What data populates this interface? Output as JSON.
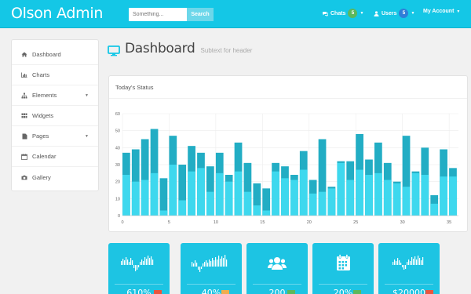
{
  "app": {
    "brand": "Olson Admin"
  },
  "search": {
    "placeholder": "Something...",
    "button_label": "Search"
  },
  "nav": {
    "chats_label": "Chats",
    "chats_count": "5",
    "users_label": "Users",
    "users_count": "5",
    "account_label": "My Account"
  },
  "sidebar": {
    "items": [
      {
        "label": "Dashboard",
        "icon": "home-icon"
      },
      {
        "label": "Charts",
        "icon": "bar-chart-icon"
      },
      {
        "label": "Elements",
        "icon": "sitemap-icon",
        "has_submenu": true
      },
      {
        "label": "Widgets",
        "icon": "grid-icon"
      },
      {
        "label": "Pages",
        "icon": "file-icon",
        "has_submenu": true
      },
      {
        "label": "Calendar",
        "icon": "calendar-icon"
      },
      {
        "label": "Gallery",
        "icon": "camera-icon"
      }
    ]
  },
  "header": {
    "title": "Dashboard",
    "subtitle": "Subtext for header",
    "icon": "monitor-icon"
  },
  "panel": {
    "title": "Today's Status"
  },
  "chart_data": {
    "type": "bar",
    "x": [
      0,
      1,
      2,
      3,
      4,
      5,
      6,
      7,
      8,
      9,
      10,
      11,
      12,
      13,
      14,
      15,
      16,
      17,
      18,
      19,
      20,
      21,
      22,
      23,
      24,
      25,
      26,
      27,
      28,
      29,
      30,
      31,
      32,
      33,
      34,
      35
    ],
    "series": [
      {
        "values": [
          37,
          39,
          45,
          51,
          22,
          47,
          30,
          41,
          37,
          29,
          37,
          24,
          43,
          31,
          19,
          16,
          31,
          29,
          24,
          38,
          21,
          45,
          17,
          32,
          32,
          48,
          33,
          43,
          31,
          20,
          47,
          26,
          40,
          12,
          39,
          28
        ]
      },
      {
        "values": [
          24,
          20,
          21,
          25,
          3,
          30,
          9,
          26,
          28,
          14,
          25,
          20,
          26,
          14,
          6,
          3,
          26,
          22,
          21,
          27,
          13,
          14,
          16,
          31,
          21,
          27,
          24,
          25,
          21,
          19,
          17,
          25,
          24,
          7,
          23,
          23
        ]
      }
    ],
    "xlim": [
      0,
      36
    ],
    "ylim": [
      0,
      60
    ],
    "xticks": [
      0,
      5,
      10,
      15,
      20,
      25,
      30,
      35
    ],
    "yticks": [
      0,
      10,
      20,
      30,
      40,
      50,
      60
    ],
    "grid": true,
    "colors": {
      "dark": "#22adc4",
      "light": "#3ed8ee"
    }
  },
  "tiles": [
    {
      "icon": "sparkline-icon",
      "value": "610%",
      "flag_color": "#e9553f"
    },
    {
      "icon": "sparkline-icon",
      "value": "40%",
      "flag_color": "#f0ad4e"
    },
    {
      "icon": "users-icon",
      "value": "200",
      "flag_color": "#5cb85c"
    },
    {
      "icon": "calendar-icon",
      "value": "20%",
      "flag_color": "#5cb85c"
    },
    {
      "icon": "sparkline-icon",
      "value": "$20000",
      "flag_color": "#e9553f"
    }
  ],
  "colors": {
    "accent": "#14c7e6",
    "tile": "#1dc4e3"
  }
}
